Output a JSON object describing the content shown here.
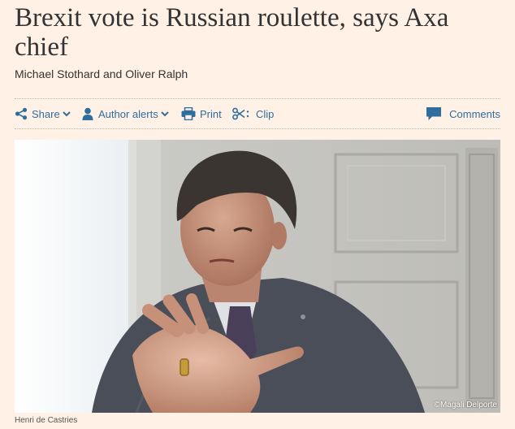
{
  "article": {
    "headline": "Brexit vote is Russian roulette, says Axa chief",
    "byline": "Michael Stothard and Oliver Ralph"
  },
  "toolbar": {
    "share_label": "Share",
    "author_alerts_label": "Author alerts",
    "print_label": "Print",
    "clip_label": "Clip",
    "comments_label": "Comments",
    "link_color": "#2e6e9e",
    "icons": [
      "share-icon",
      "user-icon",
      "printer-icon",
      "scissors-icon",
      "speech-bubble-icon",
      "chevron-down-icon"
    ]
  },
  "figure": {
    "credit": "©Magali Delporte",
    "caption": "Henri de Castries"
  },
  "colors": {
    "background": "#fff1e5",
    "text": "#333333"
  }
}
